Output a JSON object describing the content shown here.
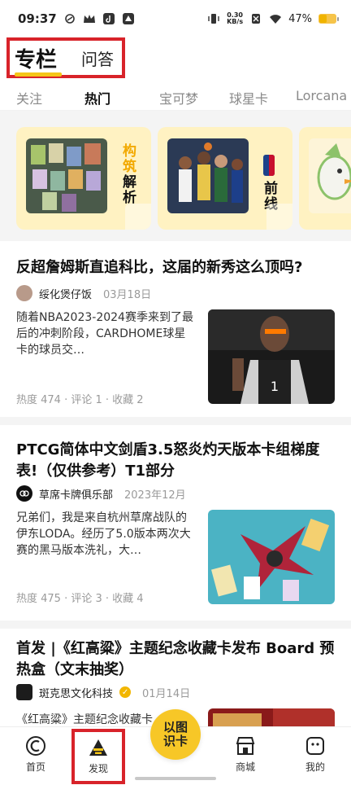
{
  "status_bar": {
    "time": "09:37",
    "net_speed_value": "0.30",
    "net_speed_unit": "KB/s",
    "battery_text": "47%",
    "battery_level": 0.47
  },
  "header": {
    "tab_primary": "专栏",
    "tab_secondary": "问答"
  },
  "categories": [
    "关注",
    "热门",
    "宝可梦",
    "球星卡",
    "Lorcana"
  ],
  "features": [
    {
      "label": "构筑解析",
      "label_top": "构筑",
      "label_bottom": "解析"
    },
    {
      "label": "前线",
      "label_top": "",
      "label_bottom": "前线"
    }
  ],
  "articles": [
    {
      "title": "反超詹姆斯直追科比，这届的新秀这么顶吗?",
      "author": "绥化煲仔饭",
      "date": "03月18日",
      "summary": "随着NBA2023-2024赛季来到了最后的冲刺阶段，CARDHOME球星卡的球员交…",
      "stats": "热度 474 · 评论 1 · 收藏 2"
    },
    {
      "title": "PTCG简体中文剑盾3.5怒炎灼天版本卡组梯度表!（仅供参考）T1部分",
      "author": "草席卡牌俱乐部",
      "date": "2023年12月",
      "summary": "兄弟们，我是来自杭州草席战队的伊东LODA。经历了5.0版本两次大赛的黑马版本洗礼，大…",
      "stats": "热度 475 · 评论 3 · 收藏 4"
    },
    {
      "title": "首发 |《红高粱》主题纪念收藏卡发布 Board 预热盒（文末抽奖）",
      "author": "斑克思文化科技",
      "date": "01月14日",
      "summary": "《红高粱》主题纪念收藏卡…"
    }
  ],
  "bottom_nav": {
    "home": "首页",
    "discover": "发现",
    "scan_line1": "以图",
    "scan_line2": "识卡",
    "shop": "商城",
    "mine": "我的"
  },
  "colors": {
    "accent_yellow": "#f5c518",
    "highlight_red": "#d8232a",
    "card_bg": "#fff2c2"
  }
}
